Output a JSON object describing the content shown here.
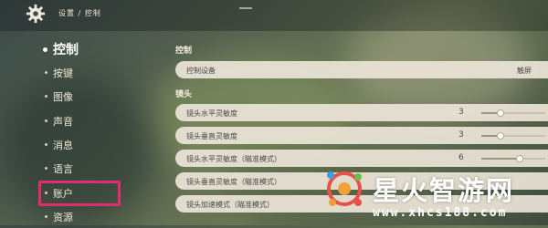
{
  "header": {
    "breadcrumb": "设置 / 控制"
  },
  "sidebar": {
    "items": [
      {
        "label": "控制",
        "active": true
      },
      {
        "label": "按键"
      },
      {
        "label": "图像"
      },
      {
        "label": "声音"
      },
      {
        "label": "消息"
      },
      {
        "label": "语言"
      },
      {
        "label": "账户",
        "highlighted": true
      },
      {
        "label": "资源"
      }
    ]
  },
  "main": {
    "sections": [
      {
        "title": "控制",
        "rows": [
          {
            "label": "控制设备",
            "value": "触屏"
          }
        ]
      },
      {
        "title": "镜头",
        "rows": [
          {
            "label": "镜头水平灵敏度",
            "value": "3",
            "slider_level": 0.3
          },
          {
            "label": "镜头垂直灵敏度",
            "value": "3",
            "slider_level": 0.3
          },
          {
            "label": "镜头水平灵敏度（瞄准模式）",
            "value": "6",
            "slider_level": 0.6
          },
          {
            "label": "镜头垂直灵敏度（瞄准模式）",
            "value": "",
            "slider_level": null
          },
          {
            "label": "镜头加速模式（瞄准模式）",
            "value": "",
            "slider_level": null
          }
        ]
      }
    ]
  },
  "watermark": {
    "text": "星火智游网",
    "url": "www.xhcs188.com"
  },
  "colors": {
    "highlight": "#e02d6f",
    "row_bg": "#ece5d6"
  },
  "icons": [
    "gear-icon",
    "watermark-logo"
  ]
}
